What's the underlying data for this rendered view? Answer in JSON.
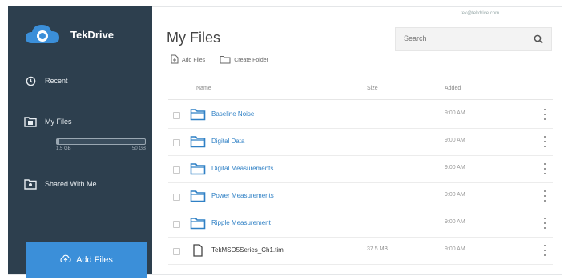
{
  "app": {
    "name": "TekDrive",
    "brand_color": "#3b8fd9",
    "sidebar_color": "#2d3f4e"
  },
  "header": {
    "user_email": "tek@tekdrive.com",
    "page_title": "My Files"
  },
  "search": {
    "placeholder": "Search",
    "icon": "search-icon"
  },
  "sidebar": {
    "items": [
      {
        "label": "Recent",
        "icon": "history-icon"
      },
      {
        "label": "My Files",
        "icon": "folder-user-icon"
      },
      {
        "label": "Shared With Me",
        "icon": "folder-shared-icon"
      }
    ],
    "storage": {
      "used_label": "1.5 GB",
      "total_label": "50 GB",
      "used_fraction": 0.03
    },
    "add_files_label": "Add Files"
  },
  "toolbar": {
    "add_files_label": "Add Files",
    "create_folder_label": "Create Folder"
  },
  "table": {
    "columns": [
      "Name",
      "Size",
      "Added"
    ],
    "rows": [
      {
        "type": "folder",
        "name": "Baseline Noise",
        "size": "",
        "added": "9:00 AM"
      },
      {
        "type": "folder",
        "name": "Digital Data",
        "size": "",
        "added": "9:00 AM"
      },
      {
        "type": "folder",
        "name": "Digital Measurements",
        "size": "",
        "added": "9:00 AM"
      },
      {
        "type": "folder",
        "name": "Power Measurements",
        "size": "",
        "added": "9:00 AM"
      },
      {
        "type": "folder",
        "name": "Ripple Measurement",
        "size": "",
        "added": "9:00 AM"
      },
      {
        "type": "file",
        "name": "TekMSO5Series_Ch1.tim",
        "size": "37.5 MB",
        "added": "9:00 AM"
      }
    ]
  }
}
